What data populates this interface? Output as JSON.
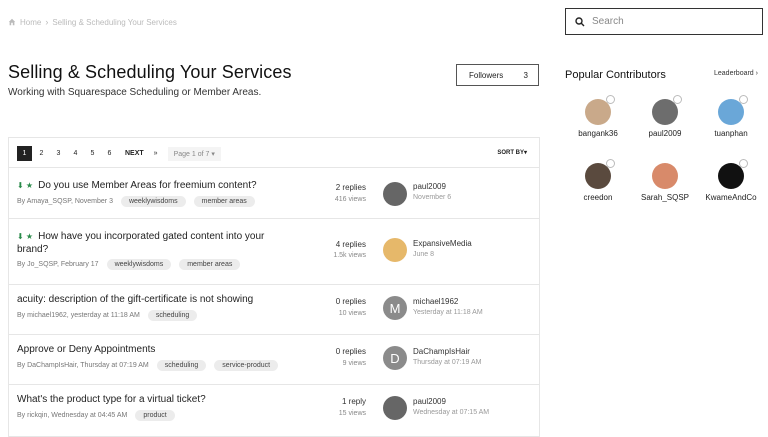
{
  "breadcrumb": {
    "home": "Home",
    "current": "Selling & Scheduling Your Services"
  },
  "header": {
    "title": "Selling & Scheduling Your Services",
    "subtitle": "Working with Squarespace Scheduling or Member Areas.",
    "followers_label": "Followers",
    "followers_count": "3"
  },
  "search": {
    "placeholder": "Search"
  },
  "sidebar": {
    "title": "Popular Contributors",
    "leaderboard": "Leaderboard",
    "contributors": [
      {
        "name": "bangank36",
        "color": "#c9a98a"
      },
      {
        "name": "paul2009",
        "color": "#6d6d6d"
      },
      {
        "name": "tuanphan",
        "color": "#6aa7d8"
      },
      {
        "name": "creedon",
        "color": "#5a4a3e"
      },
      {
        "name": "Sarah_SQSP",
        "color": "#d88a6a"
      },
      {
        "name": "KwameAndCo",
        "color": "#111111"
      }
    ]
  },
  "pager": {
    "pages": [
      "1",
      "2",
      "3",
      "4",
      "5",
      "6"
    ],
    "next": "NEXT",
    "last": "»",
    "page_of": "Page 1 of 7",
    "sort_by": "SORT BY"
  },
  "threads": [
    {
      "title": "Do you use Member Areas for freemium content?",
      "meta": "By Amaya_SQSP, November 3",
      "tags": [
        "weeklywisdoms",
        "member areas"
      ],
      "replies": "2 replies",
      "views": "416 views",
      "user": "paul2009",
      "date": "November 6"
    },
    {
      "title": "How have you incorporated gated content into your",
      "title2": "brand?",
      "meta": "By Jo_SQSP, February 17",
      "tags": [
        "weeklywisdoms",
        "member areas"
      ],
      "replies": "4 replies",
      "views": "1.5k views",
      "user": "ExpansiveMedia",
      "date": "June 8"
    },
    {
      "title": "acuity: description of the gift-certificate is not showing",
      "meta": "By michael1962, yesterday at 11:18 AM",
      "tags": [
        "scheduling"
      ],
      "replies": "0 replies",
      "views": "10 views",
      "user": "michael1962",
      "date": "Yesterday at 11:18 AM",
      "avatar_letter": "M"
    },
    {
      "title": "Approve or Deny Appointments",
      "meta": "By DaChampIsHair, Thursday at 07:19 AM",
      "tags": [
        "scheduling",
        "service-product"
      ],
      "replies": "0 replies",
      "views": "9 views",
      "user": "DaChampIsHair",
      "date": "Thursday at 07:19 AM",
      "avatar_letter": "D"
    },
    {
      "title": "What's the product type for a virtual ticket?",
      "meta": "By rickqin, Wednesday at 04:45 AM",
      "tags": [
        "product"
      ],
      "replies": "1 reply",
      "views": "15 views",
      "user": "paul2009",
      "date": "Wednesday at 07:15 AM"
    }
  ]
}
